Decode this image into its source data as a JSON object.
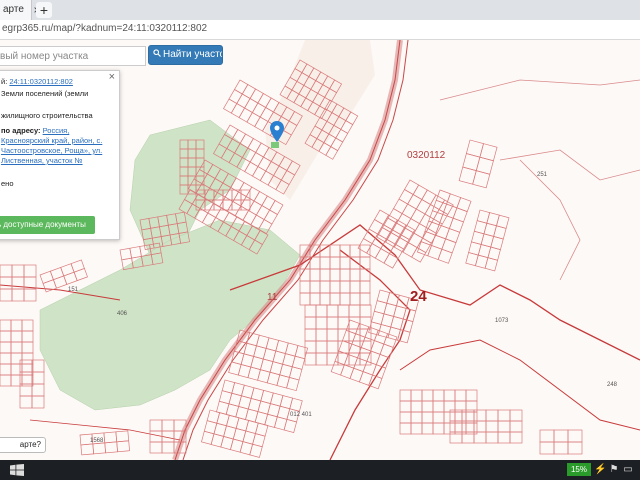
{
  "browser": {
    "tab_title": "арте",
    "tab_close": "×",
    "new_tab": "+",
    "url": "egrp365.ru/map/?kadnum=24:11:0320112:802"
  },
  "search": {
    "placeholder": "вый номер участка",
    "button_label": "Найти участок",
    "button_icon": "search-icon"
  },
  "popup": {
    "close": "×",
    "kadnum_prefix": "й:",
    "kadnum": "24:11:0320112:802",
    "category": "Земли поселений (земли",
    "use": "жилищного строительства",
    "address_label": "по адресу:",
    "address_link": "Россия, Красноярский край, район, с. Частоостровское, Роща», ул. Лиственная, участок №",
    "line_a": "ено",
    "docs_button": "ь доступные документы"
  },
  "map": {
    "labels": [
      {
        "text": "0320112",
        "cls": "mid"
      },
      {
        "text": "11",
        "cls": "mid"
      },
      {
        "text": "24",
        "cls": "big"
      },
      {
        "text": "251",
        "cls": "small"
      },
      {
        "text": "1073",
        "cls": "small"
      },
      {
        "text": "248",
        "cls": "small"
      },
      {
        "text": "406",
        "cls": "small"
      },
      {
        "text": "151",
        "cls": "small"
      },
      {
        "text": "1568",
        "cls": "small"
      },
      {
        "text": "012 401",
        "cls": "small"
      }
    ],
    "return_button": "арте?"
  },
  "taskbar": {
    "battery": "15%",
    "icons": [
      "power-icon",
      "flag-icon",
      "monitor-icon"
    ]
  },
  "colors": {
    "parcel": "#d97a7a",
    "boundary": "#c83a3a",
    "green_area": "#cfe3c6",
    "road": "#d98a8a",
    "search_btn": "#337ab7",
    "docs_btn": "#5cb85c"
  }
}
